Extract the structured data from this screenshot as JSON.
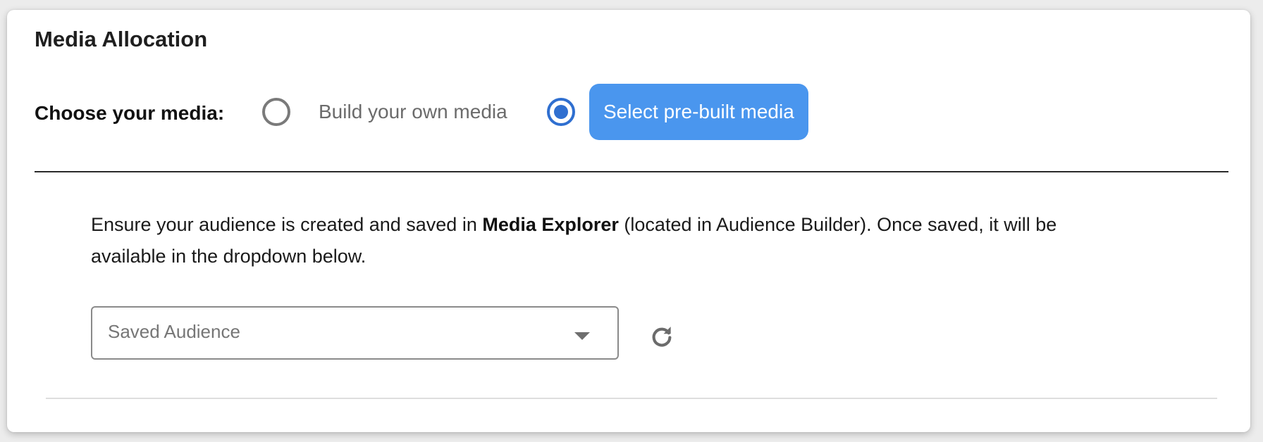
{
  "section": {
    "title": "Media Allocation"
  },
  "media_choice": {
    "label": "Choose your media:",
    "options": [
      {
        "label": "Build your own media",
        "selected": false
      },
      {
        "label": "Select pre-built media",
        "selected": true
      }
    ],
    "accent_color": "#4a96ee",
    "radio_color": "#2f6fd0"
  },
  "info": {
    "text_before": "Ensure your audience is created and saved in ",
    "bold_term": "Media Explorer",
    "text_after": " (located in Audience Builder). Once saved, it will be available in the dropdown below."
  },
  "audience_select": {
    "placeholder": "Saved Audience",
    "caret_icon": "caret-down-icon"
  },
  "refresh": {
    "icon": "refresh-icon"
  }
}
